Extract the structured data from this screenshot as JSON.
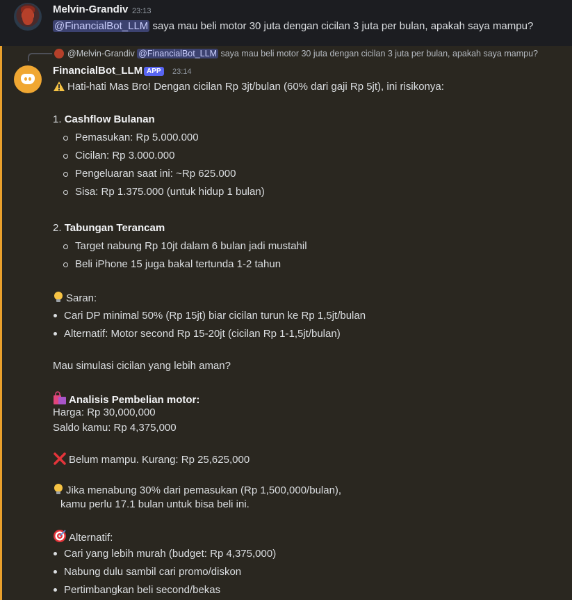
{
  "user_message": {
    "username": "Melvin-Grandiv",
    "time": "23:13",
    "mention": "@FinancialBot_LLM",
    "text": " saya mau beli motor 30 juta dengan cicilan 3 juta per bulan, apakah saya mampu?"
  },
  "bot_message": {
    "reply_preview": {
      "author": "@Melvin-Grandiv",
      "mention": "@FinancialBot_LLM",
      "text": " saya mau beli motor 30 juta dengan cicilan 3 juta per bulan, apakah saya mampu?"
    },
    "username": "FinancialBot_LLM",
    "badge": "APP",
    "time": "23:14",
    "intro": "Hati-hati Mas Bro! Dengan cicilan Rp 3jt/bulan (60% dari gaji Rp 5jt), ini risikonya:",
    "section1_num": "1.",
    "section1_title": "Cashflow Bulanan",
    "section1_items": [
      "Pemasukan: Rp 5.000.000",
      "Cicilan: Rp 3.000.000",
      "Pengeluaran saat ini: ~Rp 625.000",
      "Sisa: Rp 1.375.000 (untuk hidup 1 bulan)"
    ],
    "section2_num": "2.",
    "section2_title": "Tabungan Terancam",
    "section2_items": [
      "Target nabung Rp 10jt dalam 6 bulan jadi mustahil",
      "Beli iPhone 15 juga bakal tertunda 1-2 tahun"
    ],
    "saran_label": "Saran:",
    "saran_items": [
      "Cari DP minimal 50% (Rp 15jt) biar cicilan turun ke Rp 1,5jt/bulan",
      "Alternatif: Motor second Rp 15-20jt (cicilan Rp 1-1,5jt/bulan)"
    ],
    "question": "Mau simulasi cicilan yang lebih aman?",
    "analysis_title": "Analisis Pembelian motor:",
    "price": "Harga: Rp 30,000,000",
    "balance": "Saldo kamu: Rp 4,375,000",
    "verdict": "Belum mampu. Kurang: Rp 25,625,000",
    "tip_line1": "Jika menabung 30% dari pemasukan (Rp 1,500,000/bulan),",
    "tip_line2": "kamu perlu 17.1 bulan untuk bisa beli ini.",
    "alt_label": "Alternatif:",
    "alt_items": [
      "Cari yang lebih murah (budget: Rp 4,375,000)",
      "Nabung dulu sambil cari promo/diskon",
      "Pertimbangkan beli second/bekas"
    ]
  },
  "colors": {
    "accent_bar": "#e9a02c",
    "mention_bg": "#3c4270",
    "badge_bg": "#5865f2"
  }
}
